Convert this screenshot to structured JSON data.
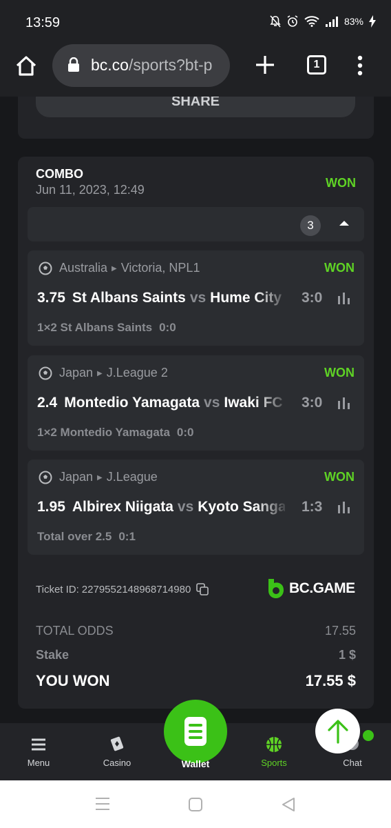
{
  "status_bar": {
    "time": "13:59",
    "battery": "83%"
  },
  "browser": {
    "url_host": "bc.co",
    "url_path": "/sports?bt-p",
    "tab_count": "1"
  },
  "share": {
    "label": "SHARE"
  },
  "bet": {
    "type": "COMBO",
    "date": "Jun 11, 2023, 12:49",
    "status": "WON",
    "selection_count": "3",
    "matches": [
      {
        "country": "Australia",
        "league": "Victoria, NPL1",
        "status": "WON",
        "odds": "3.75",
        "home": "St Albans Saints",
        "vs": "vs",
        "away": "Hume City",
        "score": "3:0",
        "market": "1×2 St Albans Saints",
        "market_result": "0:0"
      },
      {
        "country": "Japan",
        "league": "J.League 2",
        "status": "WON",
        "odds": "2.4",
        "home": "Montedio Yamagata",
        "vs": "vs",
        "away": "Iwaki FC",
        "score": "3:0",
        "market": "1×2 Montedio Yamagata",
        "market_result": "0:0"
      },
      {
        "country": "Japan",
        "league": "J.League",
        "status": "WON",
        "odds": "1.95",
        "home": "Albirex Niigata",
        "vs": "vs",
        "away": "Kyoto Sanga",
        "score": "1:3",
        "market": "Total over 2.5",
        "market_result": "0:1"
      }
    ],
    "ticket_label": "Ticket ID:",
    "ticket_id": "2279552148968714980",
    "brand": "BC.GAME",
    "total_odds_label": "TOTAL ODDS",
    "total_odds": "17.55",
    "stake_label": "Stake",
    "stake": "1 $",
    "won_label": "YOU WON",
    "won_amount": "17.55 $"
  },
  "bottom_nav": {
    "menu": "Menu",
    "casino": "Casino",
    "wallet": "Wallet",
    "sports": "Sports",
    "chat": "Chat"
  },
  "colors": {
    "accent": "#5fd325",
    "fab": "#3bc117",
    "card": "#232428",
    "row": "#2b2d31"
  }
}
